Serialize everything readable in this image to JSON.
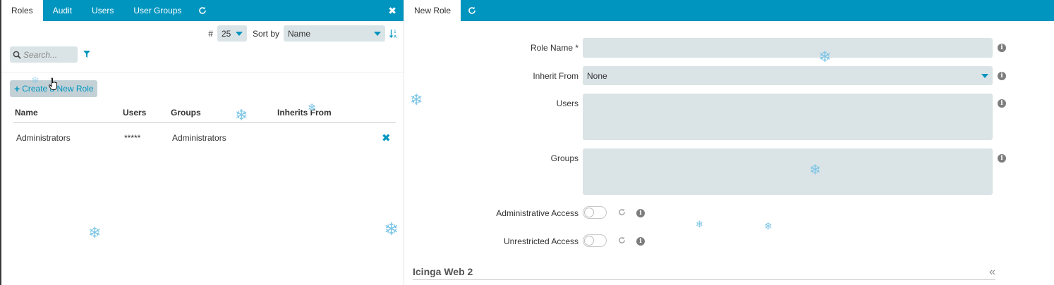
{
  "left_panel": {
    "tabs": [
      {
        "label": "Roles"
      },
      {
        "label": "Audit"
      },
      {
        "label": "Users"
      },
      {
        "label": "User Groups"
      }
    ],
    "refresh_icon": "refresh-icon",
    "close_icon": "close-icon",
    "limit_label": "#",
    "limit_value": "25",
    "sort_by_label": "Sort by",
    "sort_by_value": "Name",
    "sort_direction_icon": "sort-alpha-icon",
    "search_placeholder": "Search...",
    "create_button_label": "Create a New Role",
    "table": {
      "headers": [
        "Name",
        "Users",
        "Groups",
        "Inherits From"
      ],
      "rows": [
        {
          "name": "Administrators",
          "users": "*****",
          "groups": "Administrators",
          "inherits_from": ""
        }
      ]
    }
  },
  "right_panel": {
    "tab": {
      "label": "New Role"
    },
    "form": {
      "role_name_label": "Role Name *",
      "role_name_value": "",
      "inherit_from_label": "Inherit From",
      "inherit_from_value": "None",
      "users_label": "Users",
      "users_value": "",
      "groups_label": "Groups",
      "groups_value": "",
      "admin_access_label": "Administrative Access",
      "admin_access_on": false,
      "unrestricted_access_label": "Unrestricted Access",
      "unrestricted_access_on": false
    },
    "section_title": "Icinga Web 2",
    "collapse_icon": "double-chevron-left-icon"
  },
  "colors": {
    "accent": "#0095bf",
    "field_bg": "#dae3e6",
    "snowflake": "#7cc5e6"
  }
}
